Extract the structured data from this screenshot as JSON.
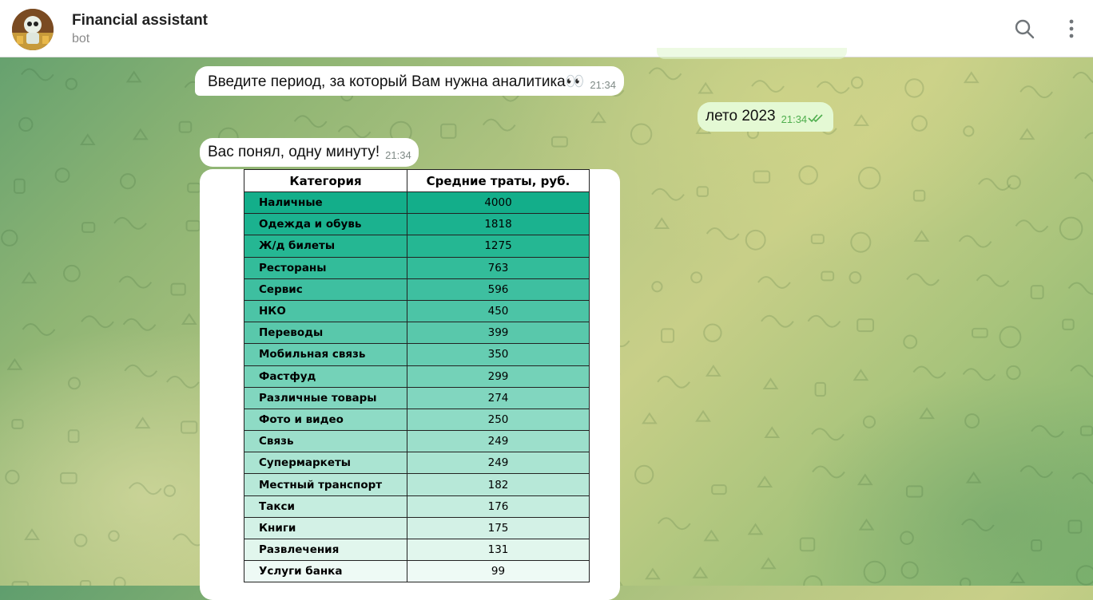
{
  "header": {
    "chat_title": "Financial assistant",
    "chat_status": "bot",
    "search_icon": "search-icon",
    "menu_icon": "more-vertical-icon"
  },
  "messages": [
    {
      "direction": "in",
      "text": "Введите период, за который Вам нужна аналитика👀",
      "time": "21:34"
    },
    {
      "direction": "out",
      "text": "лето 2023",
      "time": "21:34",
      "status_icon": "double-check-icon"
    },
    {
      "direction": "in",
      "text": "Вас понял, одну минуту!",
      "time": "21:34"
    }
  ],
  "table_image": {
    "headers": [
      "Категория",
      "Средние траты, руб."
    ],
    "rows": [
      {
        "category": "Наличные",
        "value": "4000",
        "color": "#13ae8a"
      },
      {
        "category": "Одежда и обувь",
        "value": "1818",
        "color": "#1bb28f"
      },
      {
        "category": "Ж/д билеты",
        "value": "1275",
        "color": "#25b793"
      },
      {
        "category": "Рестораны",
        "value": "763",
        "color": "#33bc9a"
      },
      {
        "category": "Сервис",
        "value": "596",
        "color": "#3ebfa0"
      },
      {
        "category": "НКО",
        "value": "450",
        "color": "#4cc4a6"
      },
      {
        "category": "Переводы",
        "value": "399",
        "color": "#59c8ab"
      },
      {
        "category": "Мобильная связь",
        "value": "350",
        "color": "#66cdb2"
      },
      {
        "category": "Фастфуд",
        "value": "299",
        "color": "#74d2b8"
      },
      {
        "category": "Различные товары",
        "value": "274",
        "color": "#81d6bf"
      },
      {
        "category": "Фото и видео",
        "value": "250",
        "color": "#8edbc5"
      },
      {
        "category": "Связь",
        "value": "249",
        "color": "#9cdfcb"
      },
      {
        "category": "Супермаркеты",
        "value": "249",
        "color": "#aae4d2"
      },
      {
        "category": "Местный транспорт",
        "value": "182",
        "color": "#b7e8d8"
      },
      {
        "category": "Такси",
        "value": "176",
        "color": "#c5eddf"
      },
      {
        "category": "Книги",
        "value": "175",
        "color": "#d3f1e6"
      },
      {
        "category": "Развлечения",
        "value": "131",
        "color": "#e1f6ed"
      },
      {
        "category": "Услуги банка",
        "value": "99",
        "color": "#eefaf5"
      }
    ]
  }
}
